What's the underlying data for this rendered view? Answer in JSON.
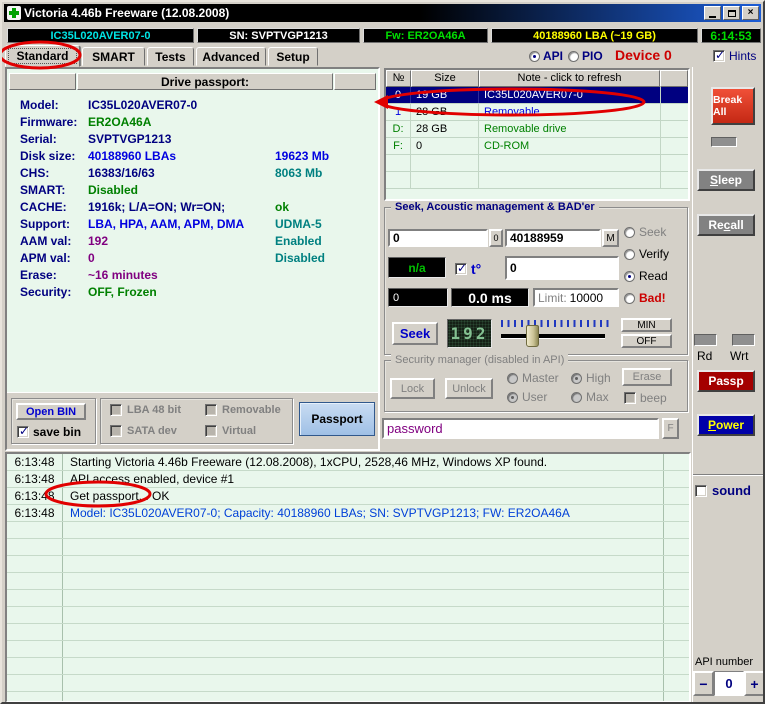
{
  "window": {
    "title": "Victoria 4.46b Freeware (12.08.2008)",
    "close_glyph": "×"
  },
  "infobar": {
    "model": "IC35L020AVER07-0",
    "serial": "SN: SVPTVGP1213",
    "firmware": "Fw: ER2OA46A",
    "capacity": "40188960 LBA (~19 GB)",
    "clock": "6:14:53"
  },
  "tabs": {
    "standard": "Standard",
    "smart": "SMART",
    "tests": "Tests",
    "advanced": "Advanced",
    "setup": "Setup"
  },
  "mode": {
    "api": "API",
    "pio": "PIO",
    "device": "Device 0",
    "hints": "Hints"
  },
  "passport": {
    "header": "Drive passport:",
    "rows": [
      {
        "label": "Model:",
        "value": "IC35L020AVER07-0",
        "extra": ""
      },
      {
        "label": "Firmware:",
        "value": "ER2OA46A",
        "extra": ""
      },
      {
        "label": "Serial:",
        "value": "SVPTVGP1213",
        "extra": ""
      },
      {
        "label": "Disk size:",
        "value": "40188960 LBAs",
        "extra": "19623 Mb"
      },
      {
        "label": "CHS:",
        "value": "16383/16/63",
        "extra": "8063 Mb"
      },
      {
        "label": "SMART:",
        "value": "Disabled",
        "extra": ""
      },
      {
        "label": "CACHE:",
        "value": "1916k; L/A=ON; Wr=ON;",
        "extra": "ok"
      },
      {
        "label": "Support:",
        "value": "LBA, HPA, AAM, APM, DMA",
        "extra": "UDMA-5"
      },
      {
        "label": "AAM val:",
        "value": "192",
        "extra": "Enabled"
      },
      {
        "label": "APM val:",
        "value": "0",
        "extra": "Disabled"
      },
      {
        "label": "Erase:",
        "value": "~16 minutes",
        "extra": ""
      },
      {
        "label": "Security:",
        "value": "OFF, Frozen",
        "extra": ""
      }
    ]
  },
  "drive_table": {
    "col_num": "№",
    "col_size": "Size",
    "col_note": "Note - click to refresh",
    "rows": [
      {
        "num": "0",
        "size": "19 GB",
        "note": "IC35L020AVER07-0"
      },
      {
        "num": "1",
        "size": "28 GB",
        "note": "Removable"
      },
      {
        "num": "D:",
        "size": "28 GB",
        "note": "Removable drive"
      },
      {
        "num": "F:",
        "size": "0",
        "note": "CD-ROM"
      }
    ]
  },
  "bin_controls": {
    "open_bin": "Open BIN",
    "save_bin": "save bin",
    "lba48": "LBA 48 bit",
    "sata": "SATA dev",
    "removable": "Removable",
    "virtual": "Virtual",
    "passport_btn": "Passport"
  },
  "seek_panel": {
    "title": "Seek, Acoustic management & BAD'er",
    "start": "0",
    "btn_zero": "0",
    "end": "40188959",
    "btn_m": "M",
    "na": "n/a",
    "temp_label": "t°",
    "temp": "0",
    "count": "0",
    "ms": "0.0 ms",
    "limit_label": "Limit:",
    "limit": "10000",
    "seek_btn": "Seek",
    "led": "192",
    "min_btn": "MIN",
    "off_btn": "OFF",
    "radio_seek": "Seek",
    "radio_verify": "Verify",
    "radio_read": "Read",
    "radio_bad": "Bad!"
  },
  "security": {
    "title": "Security manager (disabled in API)",
    "lock": "Lock",
    "unlock": "Unlock",
    "master": "Master",
    "high": "High",
    "user": "User",
    "max": "Max",
    "erase": "Erase",
    "beep": "beep",
    "password": "password",
    "f_btn": "F"
  },
  "log": {
    "rows": [
      {
        "time": "6:13:48",
        "message": "Starting Victoria 4.46b Freeware (12.08.2008), 1xCPU, 2528,46 MHz, Windows XP found."
      },
      {
        "time": "6:13:48",
        "message": "API access enabled, device #1"
      },
      {
        "time": "6:13:48",
        "message": "Get passport... OK"
      },
      {
        "time": "6:13:48",
        "message": "Model: IC35L020AVER07-0; Capacity: 40188960 LBAs; SN: SVPTVGP1213; FW: ER2OA46A"
      }
    ]
  },
  "sidebar": {
    "break_all": "Break All",
    "sleep_key": "S",
    "sleep_post": "leep",
    "recall_pre": "Re",
    "recall_key": "c",
    "recall_post": "all",
    "rd": "Rd",
    "wrt": "Wrt",
    "passp": "Passp",
    "power_key": "P",
    "power_post": "ower",
    "sound": "sound",
    "api_number_label": "API number",
    "api_value": "0",
    "minus": "−",
    "plus": "+"
  },
  "colors": {
    "annotation_red": "#E10000",
    "selected_row": "#000080",
    "panel_green": "#E9F7EC",
    "window_gray": "#D4D0C8",
    "titlebar_left": "#000000",
    "titlebar_right": "#1D5DD6",
    "break_all_bg": "#DE3722",
    "passp_bg": "#A40000",
    "power_bg": "#0000A8",
    "power_text": "#FFFF00",
    "model_cyan": "#00E5E5",
    "fw_green": "#00E000",
    "lba_yellow": "#FFFF00",
    "clock_green": "#00DD00"
  }
}
